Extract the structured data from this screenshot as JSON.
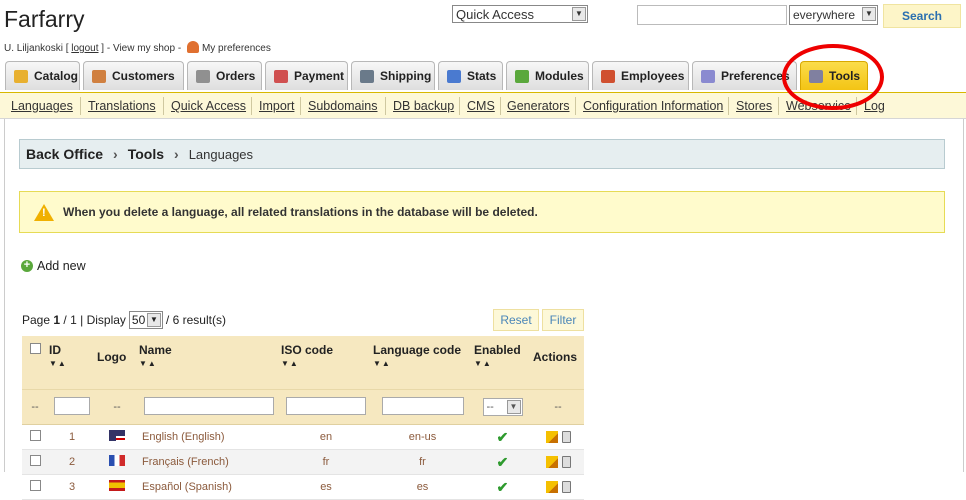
{
  "header": {
    "shop_name": "Farfarry",
    "user_name": "U. Liljankoski",
    "logout_label": "logout",
    "view_shop_label": "View my shop",
    "preferences_label": "My preferences",
    "quick_access_label": "Quick Access",
    "search_value": "",
    "search_scope": "everywhere",
    "search_button": "Search"
  },
  "tabs": [
    {
      "label": "Catalog",
      "icon": "folder-icon",
      "color": "#e8b030"
    },
    {
      "label": "Customers",
      "icon": "customers-icon",
      "color": "#d08040"
    },
    {
      "label": "Orders",
      "icon": "cart-icon",
      "color": "#909090"
    },
    {
      "label": "Payment",
      "icon": "payment-icon",
      "color": "#d05050"
    },
    {
      "label": "Shipping",
      "icon": "truck-icon",
      "color": "#6a7a8a"
    },
    {
      "label": "Stats",
      "icon": "chart-icon",
      "color": "#4a7ad0"
    },
    {
      "label": "Modules",
      "icon": "puzzle-icon",
      "color": "#5aa83c"
    },
    {
      "label": "Employees",
      "icon": "employee-icon",
      "color": "#d05030"
    },
    {
      "label": "Preferences",
      "icon": "preferences-icon",
      "color": "#8a8ad0"
    },
    {
      "label": "Tools",
      "icon": "wrench-icon",
      "color": "#8080a0"
    }
  ],
  "active_tab": "Tools",
  "subnav": [
    "Languages",
    "Translations",
    "Quick Access",
    "Import",
    "Subdomains",
    "DB backup",
    "CMS",
    "Generators",
    "Configuration Information",
    "Stores",
    "Webservice",
    "Log"
  ],
  "breadcrumb": {
    "root": "Back Office",
    "section": "Tools",
    "current": "Languages"
  },
  "warning": "When you delete a language, all related translations in the database will be deleted.",
  "add_new": "Add new",
  "pager": {
    "page_label": "Page",
    "page": "1",
    "total_pages": "1",
    "display_label": "Display",
    "per_page": "50",
    "results": "/ 6 result(s)"
  },
  "reset_button": "Reset",
  "filter_button": "Filter",
  "table": {
    "columns": [
      "ID",
      "Logo",
      "Name",
      "ISO code",
      "Language code",
      "Enabled",
      "Actions"
    ],
    "filter_placeholder": "--",
    "enabled_filter": "--",
    "rows": [
      {
        "id": "1",
        "name": "English (English)",
        "iso": "en",
        "lang_code": "en-us",
        "flag": "us-flag-icon"
      },
      {
        "id": "2",
        "name": "Français (French)",
        "iso": "fr",
        "lang_code": "fr",
        "flag": "fr-flag-icon"
      },
      {
        "id": "3",
        "name": "Español (Spanish)",
        "iso": "es",
        "lang_code": "es",
        "flag": "es-flag-icon"
      }
    ]
  },
  "colors": {
    "accent": "#f3c414",
    "highlight_circle": "#ee0000",
    "link": "#2a6fb0"
  }
}
